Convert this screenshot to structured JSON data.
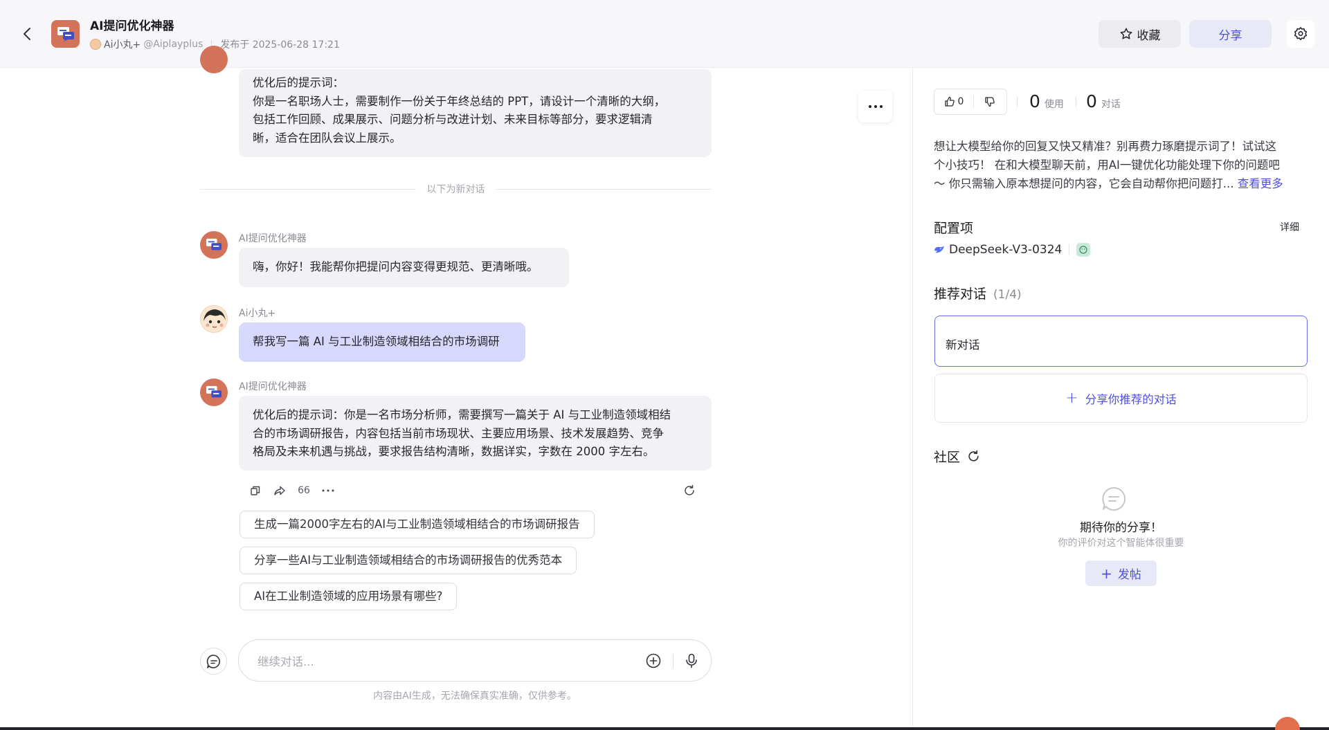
{
  "header": {
    "title": "AI提问优化神器",
    "author": "Ai小丸+",
    "handle": "@Aiplayplus",
    "published": "发布于 2025-06-28 17:21",
    "favorite_label": "收藏",
    "share_label": "分享"
  },
  "chat": {
    "top_message": {
      "lines": [
        "优化后的提示词：",
        "你是一名职场人士，需要制作一份关于年终总结的 PPT，请设计一个清晰的大纲，",
        "包括工作回顾、成果展示、问题分析与改进计划、未来目标等部分，要求逻辑清",
        "晰，适合在团队会议上展示。"
      ]
    },
    "new_conversation_divider": "以下为新对话",
    "messages": [
      {
        "sender": "AI提问优化神器",
        "lines": [
          "嗨，你好！我能帮你把提问内容变得更规范、更清晰哦。"
        ]
      },
      {
        "sender": "Ai小丸+",
        "lines": [
          "帮我写一篇 AI 与工业制造领域相结合的市场调研"
        ]
      },
      {
        "sender": "AI提问优化神器",
        "lines": [
          "优化后的提示词：你是一名市场分析师，需要撰写一篇关于 AI 与工业制造领域相结",
          "合的市场调研报告，内容包括当前市场现状、主要应用场景、技术发展趋势、竞争",
          "格局及未来机遇与挑战，要求报告结构清晰，数据详实，字数在 2000 字左右。"
        ]
      }
    ],
    "quote_label": "66",
    "suggestions": [
      "生成一篇2000字左右的AI与工业制造领域相结合的市场调研报告",
      "分享一些AI与工业制造领域相结合的市场调研报告的优秀范本",
      "AI在工业制造领域的应用场景有哪些?"
    ],
    "input_placeholder": "继续对话...",
    "disclaimer": "内容由AI生成，无法确保真实准确，仅供参考。"
  },
  "panel": {
    "likes": "0",
    "uses_count": "0",
    "uses_label": "使用",
    "dialogs_count": "0",
    "dialogs_label": "对话",
    "description_lines": [
      "想让大模型给你的回复又快又精准？别再费力琢磨提示词了！试试这",
      "个小技巧！ 在和大模型聊天前，用AI一键优化功能处理下你的问题吧",
      "～ 你只需输入原本想提问的内容，它会自动帮你把问题打..."
    ],
    "see_more": "查看更多",
    "config_title": "配置项",
    "detail_label": "详细",
    "model_name": "DeepSeek-V3-0324",
    "recommend_title": "推荐对话",
    "recommend_count": "(1/4)",
    "recommend_card": "新对话",
    "share_recommend_label": "分享你推荐的对话",
    "community_title": "社区",
    "empty_title": "期待你的分享！",
    "empty_subtitle": "你的评价对这个智能体很重要",
    "post_label": "发帖"
  },
  "colors": {
    "accent": "#4e50d8",
    "bot_avatar": "#d2735a",
    "user_bubble": "#d7d8fb",
    "bot_bubble": "#f2f2f6"
  }
}
